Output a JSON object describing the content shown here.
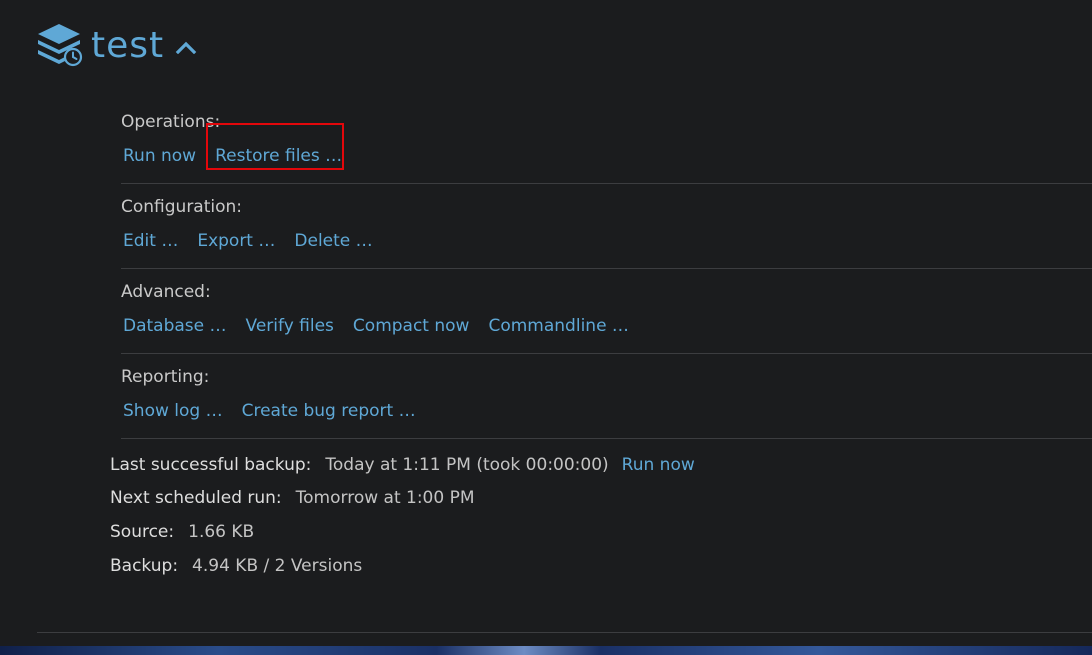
{
  "header": {
    "title": "test"
  },
  "sections": [
    {
      "label": "Operations:",
      "links": [
        "Run now",
        "Restore files …"
      ]
    },
    {
      "label": "Configuration:",
      "links": [
        "Edit …",
        "Export …",
        "Delete …"
      ]
    },
    {
      "label": "Advanced:",
      "links": [
        "Database …",
        "Verify files",
        "Compact now",
        "Commandline …"
      ]
    },
    {
      "label": "Reporting:",
      "links": [
        "Show log …",
        "Create bug report …"
      ]
    }
  ],
  "info": {
    "last_backup": {
      "label": "Last successful backup:",
      "value": "Today at 1:11 PM (took 00:00:00)",
      "link": "Run now"
    },
    "next_run": {
      "label": "Next scheduled run:",
      "value": "Tomorrow at 1:00 PM"
    },
    "source": {
      "label": "Source:",
      "value": "1.66 KB"
    },
    "backup": {
      "label": "Backup:",
      "value": "4.94 KB / 2 Versions"
    }
  },
  "colors": {
    "accent": "#5fa8d6",
    "background": "#1b1c1e",
    "highlight": "#e3070b"
  },
  "icons": {
    "logo": "database-history-icon",
    "toggle": "chevron-up-icon"
  }
}
